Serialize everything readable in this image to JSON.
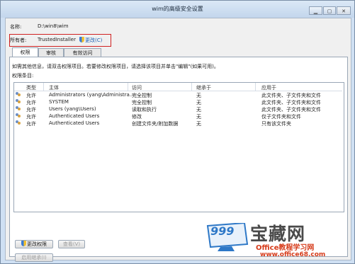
{
  "window": {
    "title": "wim的高级安全设置",
    "controls": [
      "minimize-icon",
      "maximize-icon",
      "close-icon"
    ]
  },
  "name_row": {
    "label": "名称:",
    "value": "D:\\win8\\wim"
  },
  "owner_row": {
    "label": "所有者:",
    "value": "TrustedInstaller",
    "change_link": "更改(C)"
  },
  "tabs": [
    {
      "label": "权限",
      "active": true
    },
    {
      "label": "审核",
      "active": false
    },
    {
      "label": "有效访问",
      "active": false
    }
  ],
  "instructions": "如需其他信息，请双击权限项目。若要修改权限项目，请选择该项目并单击\"编辑\"(如果可用)。",
  "entries_label": "权限条目:",
  "table": {
    "headers": [
      "类型",
      "主体",
      "访问",
      "继承于",
      "应用于"
    ],
    "rows": [
      [
        "允许",
        "Administrators (yang\\Administra...",
        "完全控制",
        "无",
        "此文件夹、子文件夹和文件"
      ],
      [
        "允许",
        "SYSTEM",
        "完全控制",
        "无",
        "此文件夹、子文件夹和文件"
      ],
      [
        "允许",
        "Users (yang\\Users)",
        "读取和执行",
        "无",
        "此文件夹、子文件夹和文件"
      ],
      [
        "允许",
        "Authenticated Users",
        "修改",
        "无",
        "仅子文件夹和文件"
      ],
      [
        "允许",
        "Authenticated Users",
        "创建文件夹/附加数据",
        "无",
        "只有该文件夹"
      ]
    ]
  },
  "buttons": {
    "change_permissions": "更改权限",
    "view": "查看(V)",
    "enable_inheritance": "启用继承(I)"
  },
  "watermark": {
    "number": "999",
    "brand": "宝藏网",
    "tagline": "Office教程学习网",
    "url": "www.office68.com"
  },
  "colors": {
    "owner_highlight": "#d02020",
    "window_frame": "#cfe0f3",
    "watermark_red": "#d63b1a"
  }
}
